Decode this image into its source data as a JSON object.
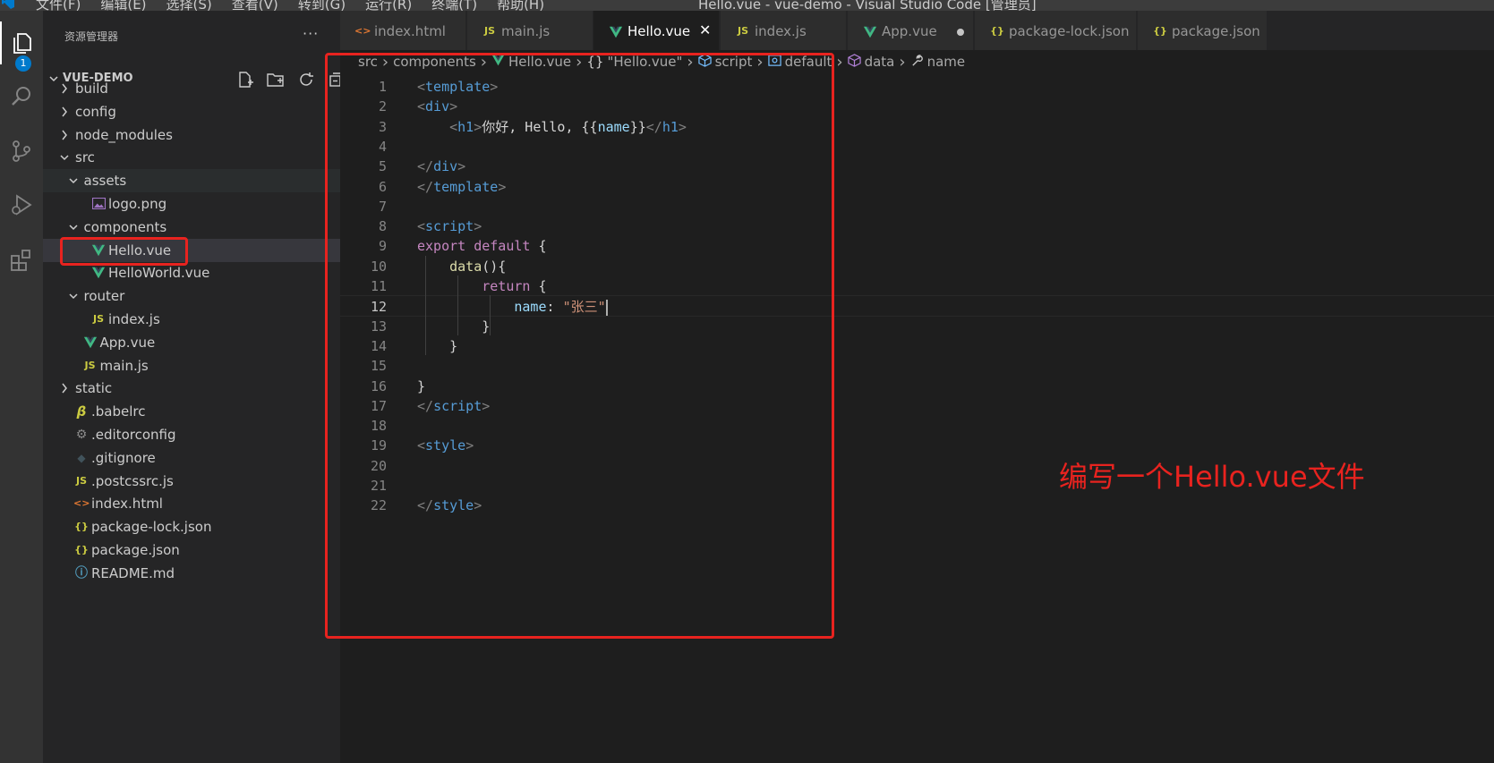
{
  "window": {
    "title": "Hello.vue - vue-demo - Visual Studio Code [管理员]",
    "menu": [
      "文件(F)",
      "编辑(E)",
      "选择(S)",
      "查看(V)",
      "转到(G)",
      "运行(R)",
      "终端(T)",
      "帮助(H)"
    ]
  },
  "activity_bar": {
    "explorer_badge": "1",
    "items": [
      "explorer-icon",
      "search-icon",
      "source-control-icon",
      "run-debug-icon",
      "extensions-icon"
    ]
  },
  "sidebar": {
    "header": "资源管理器",
    "more": "···",
    "project": "VUE-DEMO",
    "tree": [
      {
        "label": "build",
        "type": "folder",
        "expanded": false,
        "depth": 0
      },
      {
        "label": "config",
        "type": "folder",
        "expanded": false,
        "depth": 0
      },
      {
        "label": "node_modules",
        "type": "folder",
        "expanded": false,
        "depth": 0
      },
      {
        "label": "src",
        "type": "folder",
        "expanded": true,
        "depth": 0
      },
      {
        "label": "assets",
        "type": "folder",
        "expanded": true,
        "depth": 1
      },
      {
        "label": "logo.png",
        "type": "image",
        "depth": 2
      },
      {
        "label": "components",
        "type": "folder",
        "expanded": true,
        "depth": 1
      },
      {
        "label": "Hello.vue",
        "type": "vue",
        "depth": 2,
        "selected": true
      },
      {
        "label": "HelloWorld.vue",
        "type": "vue",
        "depth": 2
      },
      {
        "label": "router",
        "type": "folder",
        "expanded": true,
        "depth": 1
      },
      {
        "label": "index.js",
        "type": "js",
        "depth": 2
      },
      {
        "label": "App.vue",
        "type": "vue",
        "depth": 1
      },
      {
        "label": "main.js",
        "type": "js",
        "depth": 1
      },
      {
        "label": "static",
        "type": "folder",
        "expanded": false,
        "depth": 0
      },
      {
        "label": ".babelrc",
        "type": "babel",
        "depth": 0
      },
      {
        "label": ".editorconfig",
        "type": "gear",
        "depth": 0
      },
      {
        "label": ".gitignore",
        "type": "git",
        "depth": 0
      },
      {
        "label": ".postcssrc.js",
        "type": "js",
        "depth": 0
      },
      {
        "label": "index.html",
        "type": "html",
        "depth": 0
      },
      {
        "label": "package-lock.json",
        "type": "json",
        "depth": 0
      },
      {
        "label": "package.json",
        "type": "json",
        "depth": 0
      },
      {
        "label": "README.md",
        "type": "info",
        "depth": 0
      }
    ]
  },
  "tabs": [
    {
      "label": "index.html",
      "icon": "html",
      "active": false
    },
    {
      "label": "main.js",
      "icon": "js",
      "active": false
    },
    {
      "label": "Hello.vue",
      "icon": "vue",
      "active": true,
      "close": "✕"
    },
    {
      "label": "index.js",
      "icon": "js",
      "active": false
    },
    {
      "label": "App.vue",
      "icon": "vue",
      "active": false,
      "modified": true
    },
    {
      "label": "package-lock.json",
      "icon": "json",
      "active": false
    },
    {
      "label": "package.json",
      "icon": "json",
      "active": false
    }
  ],
  "breadcrumb": [
    "src",
    "components",
    "Hello.vue",
    "\"Hello.vue\"",
    "script",
    "default",
    "data",
    "name"
  ],
  "editor": {
    "current_line": 12,
    "lines": [
      {
        "n": "1",
        "tokens": [
          [
            "t-punc",
            "<"
          ],
          [
            "t-tag",
            "template"
          ],
          [
            "t-punc",
            ">"
          ]
        ]
      },
      {
        "n": "2",
        "tokens": [
          [
            "t-punc",
            "<"
          ],
          [
            "t-tag",
            "div"
          ],
          [
            "t-punc",
            ">"
          ]
        ]
      },
      {
        "n": "3",
        "tokens": [
          [
            "t-text",
            "    "
          ],
          [
            "t-punc",
            "<"
          ],
          [
            "t-tag",
            "h1"
          ],
          [
            "t-punc",
            ">"
          ],
          [
            "t-text",
            "你好, Hello, {{"
          ],
          [
            "t-prop",
            "name"
          ],
          [
            "t-text",
            "}}"
          ],
          [
            "t-punc",
            "</"
          ],
          [
            "t-tag",
            "h1"
          ],
          [
            "t-punc",
            ">"
          ]
        ]
      },
      {
        "n": "4",
        "tokens": []
      },
      {
        "n": "5",
        "tokens": [
          [
            "t-punc",
            "</"
          ],
          [
            "t-tag",
            "div"
          ],
          [
            "t-punc",
            ">"
          ]
        ]
      },
      {
        "n": "6",
        "tokens": [
          [
            "t-punc",
            "</"
          ],
          [
            "t-tag",
            "template"
          ],
          [
            "t-punc",
            ">"
          ]
        ]
      },
      {
        "n": "7",
        "tokens": []
      },
      {
        "n": "8",
        "tokens": [
          [
            "t-punc",
            "<"
          ],
          [
            "t-tag",
            "script"
          ],
          [
            "t-punc",
            ">"
          ]
        ]
      },
      {
        "n": "9",
        "tokens": [
          [
            "t-kw",
            "export"
          ],
          [
            "t-text",
            " "
          ],
          [
            "t-kw",
            "default"
          ],
          [
            "t-text",
            " {"
          ]
        ]
      },
      {
        "n": "10",
        "tokens": [
          [
            "t-text",
            "    "
          ],
          [
            "t-fn",
            "data"
          ],
          [
            "t-text",
            "(){"
          ]
        ]
      },
      {
        "n": "11",
        "tokens": [
          [
            "t-text",
            "        "
          ],
          [
            "t-kw",
            "return"
          ],
          [
            "t-text",
            " {"
          ]
        ]
      },
      {
        "n": "12",
        "tokens": [
          [
            "t-text",
            "            "
          ],
          [
            "t-prop",
            "name"
          ],
          [
            "t-text",
            ": "
          ],
          [
            "t-str",
            "\"张三\""
          ]
        ],
        "cursor": true
      },
      {
        "n": "13",
        "tokens": [
          [
            "t-text",
            "        }"
          ]
        ]
      },
      {
        "n": "14",
        "tokens": [
          [
            "t-text",
            "    }"
          ]
        ]
      },
      {
        "n": "15",
        "tokens": []
      },
      {
        "n": "16",
        "tokens": [
          [
            "t-text",
            "}"
          ]
        ]
      },
      {
        "n": "17",
        "tokens": [
          [
            "t-punc",
            "</"
          ],
          [
            "t-tag",
            "script"
          ],
          [
            "t-punc",
            ">"
          ]
        ]
      },
      {
        "n": "18",
        "tokens": []
      },
      {
        "n": "19",
        "tokens": [
          [
            "t-punc",
            "<"
          ],
          [
            "t-tag",
            "style"
          ],
          [
            "t-punc",
            ">"
          ]
        ]
      },
      {
        "n": "20",
        "tokens": []
      },
      {
        "n": "21",
        "tokens": []
      },
      {
        "n": "22",
        "tokens": [
          [
            "t-punc",
            "</"
          ],
          [
            "t-tag",
            "style"
          ],
          [
            "t-punc",
            ">"
          ]
        ]
      }
    ]
  },
  "annotation": "编写一个Hello.vue文件",
  "colors": {
    "annotation_red": "#e8231f",
    "vue_green": "#41b883",
    "js_yellow": "#cbcb41",
    "accent_blue": "#007acc"
  }
}
